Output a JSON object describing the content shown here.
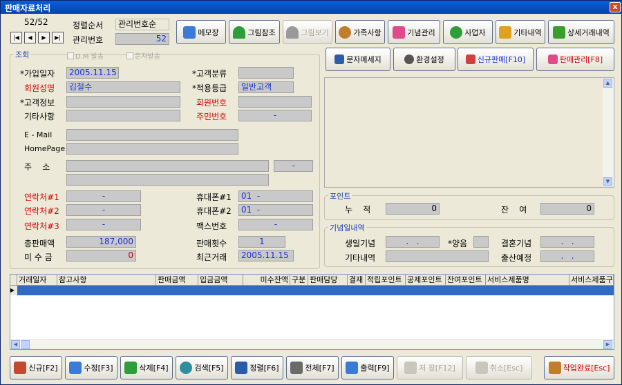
{
  "window": {
    "title": "판매자료처리",
    "close": "x"
  },
  "nav": {
    "counter": "52/52",
    "first": "|◀",
    "prev": "◀",
    "next": "▶",
    "last": "▶|"
  },
  "header": {
    "sort_label": "정렬순서",
    "sort_value": "관리번호순",
    "id_label": "관리번호",
    "id_value": "52"
  },
  "toolbar": [
    {
      "label": "메모장",
      "icon": "memo-icon",
      "color": "#3A7BD5"
    },
    {
      "label": "그림참조",
      "icon": "tree-icon",
      "color": "#2E9E3A"
    },
    {
      "label": "그림보기",
      "icon": "tree-icon",
      "color": "#9A9A9A"
    },
    {
      "label": "가족사항",
      "icon": "family-icon",
      "color": "#C27C2E"
    },
    {
      "label": "기념관리",
      "icon": "gift-icon",
      "color": "#E04C8A"
    },
    {
      "label": "사업자",
      "icon": "person-icon",
      "color": "#2E9E3A"
    },
    {
      "label": "기타내역",
      "icon": "list-icon",
      "color": "#E0A020"
    },
    {
      "label": "상세거래내역",
      "icon": "detail-icon",
      "color": "#3A9E2E"
    }
  ],
  "actions": [
    {
      "label": "문자메세지",
      "icon": "phone-icon",
      "color": "#2A5CA8"
    },
    {
      "label": "환경설정",
      "icon": "settings-icon",
      "color": "#555555"
    },
    {
      "label": "신규판매[F10]",
      "icon": "new-sale-icon",
      "color": "#1A2FD0"
    },
    {
      "label": "판매관리[F8]",
      "icon": "sale-manage-icon",
      "color": "#D00000"
    }
  ],
  "inquiry": {
    "title": "조회",
    "dm": "D.M 발송",
    "sms": "문자발송",
    "join_date_label": "*가입일자",
    "join_date": "2005.11.15",
    "class_label": "*고객분류",
    "class_value": "",
    "name_label": "회원성명",
    "name": "김철수",
    "grade_label": "*적용등급",
    "grade": "일반고객",
    "info_label": "*고객정보",
    "info": "",
    "member_no_label": "회원번호",
    "member_no": "",
    "etc_label": "기타사항",
    "etc": "",
    "rrn_label": "주민번호",
    "rrn": "-",
    "email_label": "E - Mail",
    "email": "",
    "homepage_label": "HomePage",
    "homepage": "",
    "address_label": "주    소",
    "zip": "-",
    "contact1_label": "연락처#1",
    "contact1": "-",
    "mobile1_label": "휴대폰#1",
    "mobile1": "01  -",
    "contact2_label": "연락처#2",
    "contact2": "-",
    "mobile2_label": "휴대폰#2",
    "mobile2": "01  -",
    "contact3_label": "연락처#3",
    "contact3": "-",
    "fax_label": "팩스번호",
    "fax": "-",
    "total_label": "총판매액",
    "total": "187,000",
    "count_label": "판매횟수",
    "count": "1",
    "unpaid_label": "미 수 금",
    "unpaid": "0",
    "last_label": "최근거래",
    "last": "2005.11.15"
  },
  "points": {
    "title": "포인트",
    "acc_label": "누    적",
    "acc": "0",
    "bal_label": "잔    여",
    "bal": "0"
  },
  "anniv": {
    "title": "기념일내역",
    "birth_label": "생일기념",
    "birth": ".   .",
    "lunar_label": "*양음",
    "wedding_label": "결혼기념",
    "wedding": ".   .",
    "etc_label": "기타내역",
    "due_label": "출산예정",
    "due": ".   ."
  },
  "grid": {
    "columns": [
      "거래일자",
      "참고사항",
      "판매금액",
      "입금금액",
      "미수잔액",
      "구분",
      "판매담당",
      "결재",
      "적립포인트",
      "공제포인트",
      "잔여포인트",
      "서비스제품명",
      "서비스제품구"
    ]
  },
  "bottom": [
    {
      "label": "신규[F2]",
      "icon": "new-icon",
      "color": "#C24A2E",
      "disabled": false
    },
    {
      "label": "수정[F3]",
      "icon": "edit-icon",
      "color": "#3A7BD5",
      "disabled": false
    },
    {
      "label": "삭제[F4]",
      "icon": "delete-icon",
      "color": "#2E9E3A",
      "disabled": false
    },
    {
      "label": "검색[F5]",
      "icon": "search-icon",
      "color": "#2E8E9E",
      "disabled": false
    },
    {
      "label": "정렬[F6]",
      "icon": "sort-icon",
      "color": "#2A5CA8",
      "disabled": false
    },
    {
      "label": "전체[F7]",
      "icon": "all-icon",
      "color": "#6A6A6A",
      "disabled": false
    },
    {
      "label": "출력[F9]",
      "icon": "print-icon",
      "color": "#3A7BD5",
      "disabled": false
    },
    {
      "label": "저 장[F12]",
      "icon": "save-icon",
      "color": "#A8A79B",
      "disabled": true
    },
    {
      "label": "취소[Esc]",
      "icon": "cancel-icon",
      "color": "#A8A79B",
      "disabled": true
    },
    {
      "label": "작업완료[Esc]",
      "icon": "exit-icon",
      "color": "#C27C2E",
      "disabled": false
    }
  ]
}
